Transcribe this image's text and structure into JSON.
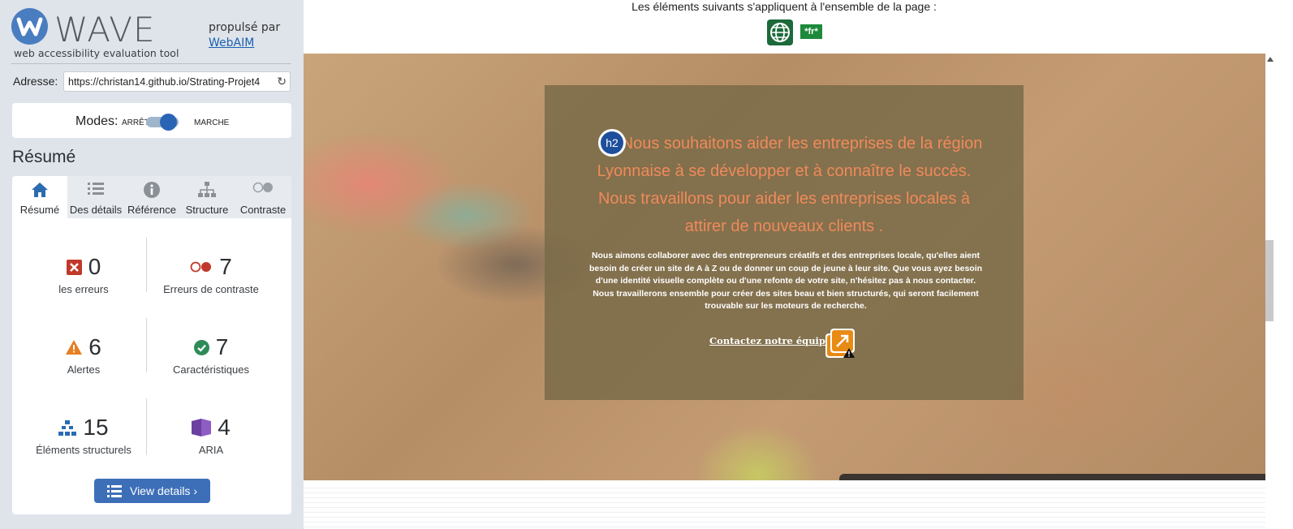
{
  "sidebar": {
    "logo_text": "WAVE",
    "tagline": "web accessibility evaluation tool",
    "powered_by": "propulsé par",
    "powered_link": "WebAIM",
    "address_label": "Adresse:",
    "address_value": "https://christan14.github.io/Strating-Projet4",
    "modes_label": "Modes:",
    "mode_off": "ARRÊT",
    "mode_on": "MARCHE",
    "summary_title": "Résumé",
    "tabs": [
      {
        "label": "Résumé",
        "icon": "home-icon"
      },
      {
        "label": "Des détails",
        "icon": "list-icon"
      },
      {
        "label": "Référence",
        "icon": "info-icon"
      },
      {
        "label": "Structure",
        "icon": "hierarchy-icon"
      },
      {
        "label": "Contraste",
        "icon": "contrast-icon"
      }
    ],
    "stats": {
      "errors": {
        "value": "0",
        "label": "les erreurs",
        "color": "#c0392b"
      },
      "contrast": {
        "value": "7",
        "label": "Erreurs de contraste",
        "color": "#c0392b"
      },
      "alerts": {
        "value": "6",
        "label": "Alertes",
        "color": "#e67e22"
      },
      "features": {
        "value": "7",
        "label": "Caractéristiques",
        "color": "#2e8b57"
      },
      "structure": {
        "value": "15",
        "label": "Éléments structurels",
        "color": "#2b6cb0"
      },
      "aria": {
        "value": "4",
        "label": "ARIA",
        "color": "#6b3fa0"
      }
    },
    "view_details": "View details ›"
  },
  "main": {
    "doc_note": "Les éléments suivants s'appliquent à l'ensemble de la page :",
    "lang_badge": "*fr*",
    "h2_badge": "h2",
    "headline": "Nous souhaitons aider les entreprises de la région Lyonnaise à se développer et à connaître le succès. Nous travaillons pour aider les entreprises locales à attirer de nouveaux clients .",
    "body": "Nous aimons collaborer avec des entrepreneurs créatifs et des entreprises locale, qu'elles aient besoin de créer un site de A à Z ou de donner un coup de jeune à leur site. Que vous ayez besoin d'une identité visuelle complète ou d'une refonte de votre site, n'hésitez pas à nous contacter. Nous travaillerons ensemble pour créer des sites beau et bien structurés, qui seront facilement trouvable sur les moteurs de recherche.",
    "contact_link": "Contactez notre équipe"
  }
}
